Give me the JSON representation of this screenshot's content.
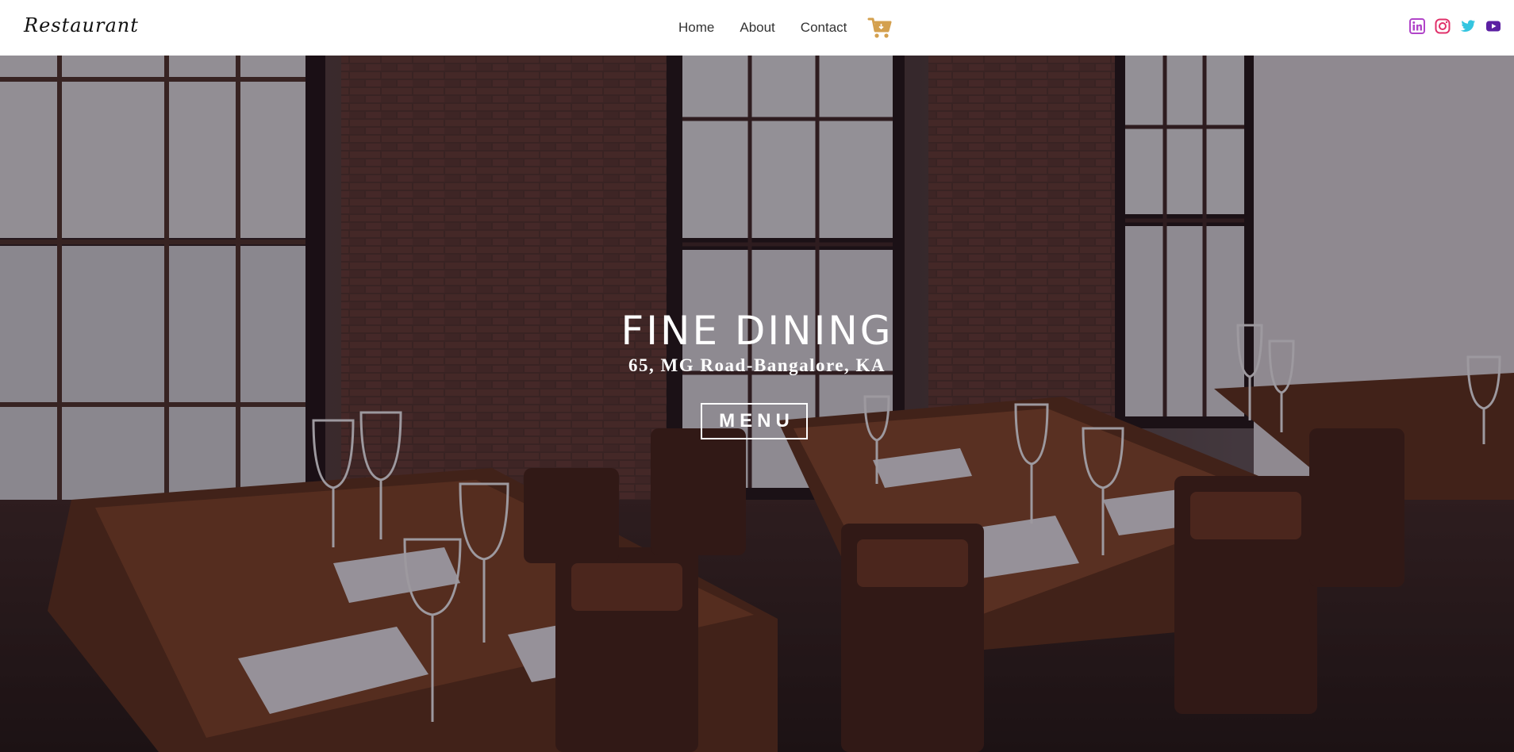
{
  "navbar": {
    "logo": "Restaurant",
    "links": [
      "Home",
      "About",
      "Contact"
    ],
    "cart_icon": "shopping-cart-icon",
    "cart_color": "#d4a04e",
    "socials": [
      {
        "icon": "linkedin-icon",
        "color": "#b145c9"
      },
      {
        "icon": "instagram-icon",
        "color": "#e0306a"
      },
      {
        "icon": "twitter-icon",
        "color": "#34c5e0"
      },
      {
        "icon": "youtube-icon",
        "color": "#5b1fa2"
      }
    ]
  },
  "hero": {
    "title": "FINE DINING",
    "address": "65, MG Road-Bangalore, KA",
    "button_label": "MENU"
  }
}
